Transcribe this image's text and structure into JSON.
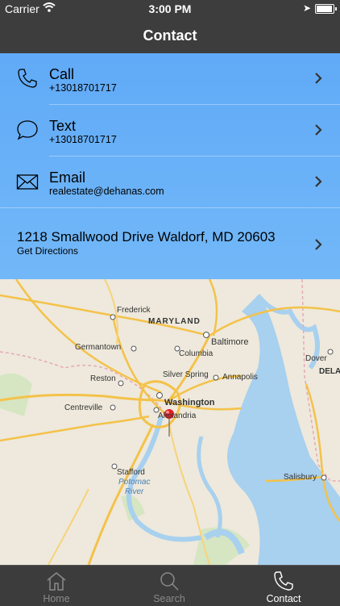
{
  "status_bar": {
    "carrier": "Carrier",
    "time": "3:00 PM"
  },
  "nav": {
    "title": "Contact"
  },
  "contact": {
    "call": {
      "label": "Call",
      "value": "+13018701717"
    },
    "text": {
      "label": "Text",
      "value": "+13018701717"
    },
    "email": {
      "label": "Email",
      "value": "realestate@dehanas.com"
    },
    "address": {
      "label": "1218 Smallwood Drive Waldorf, MD 20603",
      "action": "Get Directions"
    }
  },
  "map": {
    "labels": {
      "maryland": "MARYLAND",
      "frederick": "Frederick",
      "baltimore": "Baltimore",
      "germantown": "Germantown",
      "columbia": "Columbia",
      "dover": "Dover",
      "dela": "DELA",
      "reston": "Reston",
      "silver_spring": "Silver Spring",
      "annapolis": "Annapolis",
      "centreville": "Centreville",
      "washington": "Washington",
      "alexandria": "Alexandria",
      "stafford": "Stafford",
      "potomac": "Potomac",
      "river": "River",
      "salisbury": "Salisbury"
    },
    "colors": {
      "land": "#eee9dc",
      "water": "#a8d0ef",
      "road": "#f4c24a",
      "park": "#cfe3b8"
    }
  },
  "tabs": [
    {
      "label": "Home",
      "icon": "home-icon"
    },
    {
      "label": "Search",
      "icon": "search-icon"
    },
    {
      "label": "Contact",
      "icon": "phone-icon",
      "active": true
    }
  ]
}
